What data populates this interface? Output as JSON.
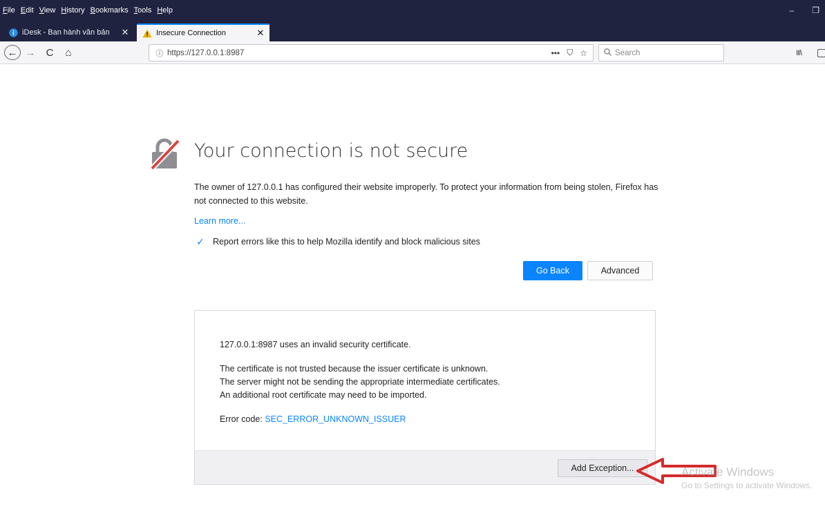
{
  "menu": [
    "File",
    "Edit",
    "View",
    "History",
    "Bookmarks",
    "Tools",
    "Help"
  ],
  "window_controls": {
    "minimize": "–",
    "restore": "❐"
  },
  "tabs": [
    {
      "title": "iDesk - Ban hành văn bản",
      "close": "✕",
      "icon": "info-circle-icon"
    },
    {
      "title": "Insecure Connection",
      "close": "✕",
      "icon": "warning-icon"
    }
  ],
  "new_tab": "+",
  "nav": {
    "back": "←",
    "forward": "→",
    "reload": "C",
    "home": "⌂",
    "url_info": "ⓘ",
    "url": "https://127.0.0.1:8987",
    "page_actions": "•••",
    "pocket": "⛉",
    "bookmark_star": "☆",
    "search_placeholder": "Search",
    "library": "III\\"
  },
  "error_page": {
    "title": "Your connection is not secure",
    "description": "The owner of 127.0.0.1 has configured their website improperly. To protect your information from being stolen, Firefox has not connected to this website.",
    "learn_more": "Learn more...",
    "checkbox_checked": "✓",
    "checkbox_label": "Report errors like this to help Mozilla identify and block malicious sites",
    "go_back": "Go Back",
    "advanced": "Advanced"
  },
  "advanced_panel": {
    "line1": "127.0.0.1:8987 uses an invalid security certificate.",
    "line2": "The certificate is not trusted because the issuer certificate is unknown.",
    "line3": "The server might not be sending the appropriate intermediate certificates.",
    "line4": "An additional root certificate may need to be imported.",
    "error_code_label": "Error code: ",
    "error_code": "SEC_ERROR_UNKNOWN_ISSUER",
    "add_exception": "Add Exception..."
  },
  "watermark": {
    "line1": "Activate Windows",
    "line2": "Go to Settings to activate Windows."
  },
  "colors": {
    "accent": "#0a84ff",
    "titlebar": "#202340",
    "arrow": "#d42b2b",
    "lock": "#d7463f"
  }
}
